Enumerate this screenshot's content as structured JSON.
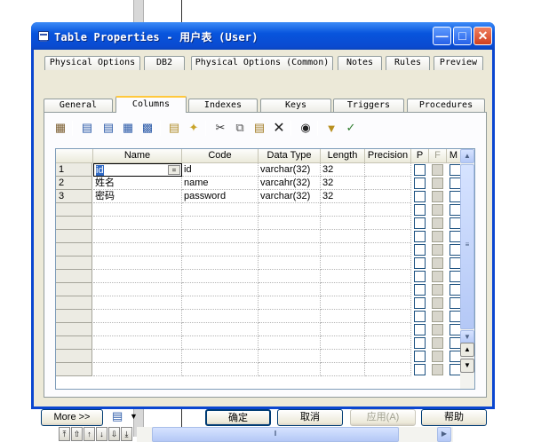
{
  "window": {
    "title": "Table Properties - 用户表 (User)"
  },
  "tabs_top": [
    "Physical Options",
    "DB2",
    "Physical Options (Common)",
    "Notes",
    "Rules",
    "Preview"
  ],
  "tabs_bottom": [
    "General",
    "Columns",
    "Indexes",
    "Keys",
    "Triggers",
    "Procedures"
  ],
  "active_tab": "Columns",
  "toolbar_icons": [
    "properties-icon",
    "insert-row-icon",
    "add-row-icon",
    "add-columns-icon",
    "reuse-columns-icon",
    "new-item-icon",
    "customize-icon",
    "cut-icon",
    "copy-icon",
    "paste-icon",
    "delete-icon",
    "find-icon",
    "filter-icon",
    "customize-columns-icon"
  ],
  "grid": {
    "headers": [
      "Name",
      "Code",
      "Data Type",
      "Length",
      "Precision",
      "P",
      "F",
      "M"
    ],
    "rows": [
      {
        "num": "1",
        "name": "id",
        "code": "id",
        "type": "varchar(32)",
        "length": "32",
        "precision": ""
      },
      {
        "num": "2",
        "name": "姓名",
        "code": "name",
        "type": "varcahr(32)",
        "length": "32",
        "precision": ""
      },
      {
        "num": "3",
        "name": "密码",
        "code": "password",
        "type": "varchar(32)",
        "length": "32",
        "precision": ""
      }
    ],
    "edit_button_label": "="
  },
  "buttons": {
    "more": "More >>",
    "ok": "确定",
    "cancel": "取消",
    "apply": "应用(A)",
    "help": "帮助"
  },
  "colors": {
    "titlebar": "#0a46d0",
    "dialog_bg": "#ece9d8",
    "active_tab_accent": "#ffc83c"
  }
}
